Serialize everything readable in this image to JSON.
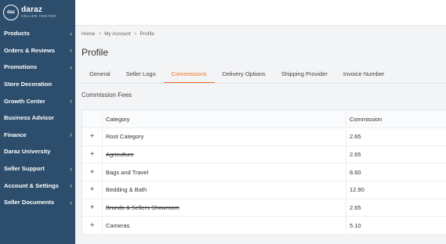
{
  "brand": {
    "badge": "daz",
    "name": "daraz",
    "sub": "SELLER CENTER"
  },
  "sidebar": {
    "items": [
      {
        "label": "Products",
        "chevron": true
      },
      {
        "label": "Orders & Reviews",
        "chevron": true
      },
      {
        "label": "Promotions",
        "chevron": true
      },
      {
        "label": "Store Decoration",
        "chevron": false
      },
      {
        "label": "Growth Center",
        "chevron": true
      },
      {
        "label": "Business Advisor",
        "chevron": false
      },
      {
        "label": "Finance",
        "chevron": true
      },
      {
        "label": "Daraz University",
        "chevron": false
      },
      {
        "label": "Seller Support",
        "chevron": true
      },
      {
        "label": "Account & Settings",
        "chevron": true
      },
      {
        "label": "Seller Documents",
        "chevron": true
      }
    ]
  },
  "breadcrumb": [
    "Home",
    "My Account",
    "Profile"
  ],
  "breadcrumb_sep": ">",
  "page_title": "Profile",
  "tabs": [
    {
      "label": "General",
      "active": false
    },
    {
      "label": "Seller Logo",
      "active": false
    },
    {
      "label": "Commissions",
      "active": true
    },
    {
      "label": "Delivery Options",
      "active": false
    },
    {
      "label": "Shipping Provider",
      "active": false
    },
    {
      "label": "Invoice Number",
      "active": false
    }
  ],
  "section_title": "Commission Fees",
  "table": {
    "headers": {
      "category": "Category",
      "commission": "Commission"
    },
    "rows": [
      {
        "category": "Root Category",
        "commission": "2.65",
        "strikethrough": false
      },
      {
        "category": "Agriculture",
        "commission": "2.65",
        "strikethrough": true
      },
      {
        "category": "Bags and Travel",
        "commission": "8.60",
        "strikethrough": false
      },
      {
        "category": "Bedding & Bath",
        "commission": "12.90",
        "strikethrough": false
      },
      {
        "category": "Brands & Sellers Showroom",
        "commission": "2.65",
        "strikethrough": true
      },
      {
        "category": "Cameras",
        "commission": "5.10",
        "strikethrough": false
      }
    ],
    "expand_glyph": "+"
  },
  "colors": {
    "sidebar": "#2c4d6b",
    "accent": "#f36f21"
  },
  "icons": {
    "chevron": "chevron-right-icon",
    "expand": "plus-icon"
  }
}
